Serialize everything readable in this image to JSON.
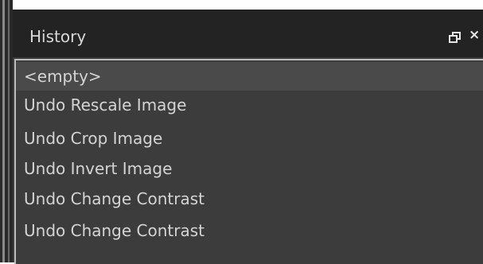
{
  "panel": {
    "title": "History",
    "float_icon": "float-window-icon",
    "close_icon": "close-icon",
    "close_glyph": "×"
  },
  "history": {
    "items": [
      {
        "label": "<empty>",
        "current": true
      },
      {
        "label": "Undo Rescale Image"
      },
      {
        "label": "Undo Crop Image"
      },
      {
        "label": "Undo Invert Image"
      },
      {
        "label": "Undo Change Contrast"
      },
      {
        "label": "Undo Change Contrast"
      }
    ]
  },
  "colors": {
    "panel_background": "#3c3c3c",
    "titlebar_background": "#232323",
    "text": "#d4d4d4",
    "list_border": "#bdbdbd"
  }
}
